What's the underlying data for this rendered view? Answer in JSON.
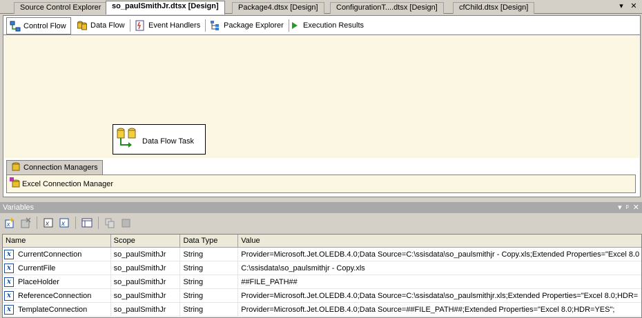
{
  "doc_tabs": [
    {
      "label": "Source Control Explorer",
      "active": false
    },
    {
      "label": "so_paulSmithJr.dtsx [Design]",
      "active": true
    },
    {
      "label": "Package4.dtsx [Design]",
      "active": false
    },
    {
      "label": "ConfigurationT....dtsx [Design]",
      "active": false
    },
    {
      "label": "cfChild.dtsx [Design]",
      "active": false
    }
  ],
  "doc_controls": {
    "dropdown": "▾",
    "close": "✕"
  },
  "designer_tabs": [
    {
      "label": "Control Flow",
      "icon": "control-flow-icon"
    },
    {
      "label": "Data Flow",
      "icon": "data-flow-icon"
    },
    {
      "label": "Event Handlers",
      "icon": "event-handlers-icon"
    },
    {
      "label": "Package Explorer",
      "icon": "package-explorer-icon"
    },
    {
      "label": "Execution Results",
      "icon": "execution-results-icon"
    }
  ],
  "task": {
    "label": "Data Flow Task",
    "icon": "data-flow-task-icon"
  },
  "connection_managers": {
    "tab_label": "Connection Managers",
    "items": [
      {
        "label": "Excel Connection Manager",
        "icon": "excel-connection-icon"
      }
    ]
  },
  "variables": {
    "title": "Variables",
    "title_controls": [
      "▾",
      "ᵖ",
      "✕"
    ],
    "columns": [
      "Name",
      "Scope",
      "Data Type",
      "Value"
    ],
    "rows": [
      {
        "name": "CurrentConnection",
        "scope": "so_paulSmithJr",
        "type": "String",
        "value": "Provider=Microsoft.Jet.OLEDB.4.0;Data Source=C:\\ssisdata\\so_paulsmithjr - Copy.xls;Extended Properties=\"Excel 8.0"
      },
      {
        "name": "CurrentFile",
        "scope": "so_paulSmithJr",
        "type": "String",
        "value": "C:\\ssisdata\\so_paulsmithjr - Copy.xls"
      },
      {
        "name": "PlaceHolder",
        "scope": "so_paulSmithJr",
        "type": "String",
        "value": "##FILE_PATH##"
      },
      {
        "name": "ReferenceConnection",
        "scope": "so_paulSmithJr",
        "type": "String",
        "value": "Provider=Microsoft.Jet.OLEDB.4.0;Data Source=C:\\ssisdata\\so_paulsmithjr.xls;Extended Properties=\"Excel 8.0;HDR="
      },
      {
        "name": "TemplateConnection",
        "scope": "so_paulSmithJr",
        "type": "String",
        "value": "Provider=Microsoft.Jet.OLEDB.4.0;Data Source=##FILE_PATH##;Extended Properties=\"Excel 8.0;HDR=YES\";"
      }
    ]
  }
}
